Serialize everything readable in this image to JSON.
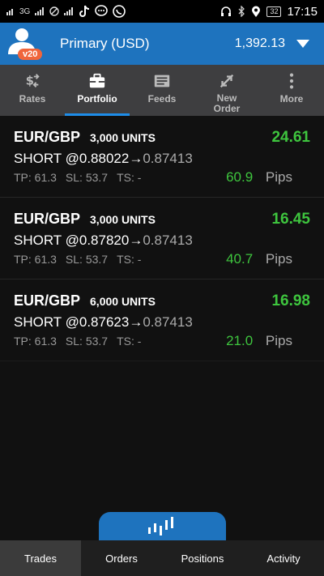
{
  "status_bar": {
    "left_text": "3G",
    "battery": "32",
    "time": "17:15"
  },
  "header": {
    "avatar_badge": "v20",
    "account_name": "Primary (USD)",
    "balance": "1,392.13"
  },
  "nav": [
    {
      "label": "Rates",
      "icon": "rates-icon"
    },
    {
      "label": "Portfolio",
      "icon": "briefcase-icon",
      "active": true
    },
    {
      "label": "Feeds",
      "icon": "feeds-icon"
    },
    {
      "label": "New Order",
      "icon": "new-order-icon"
    },
    {
      "label": "More",
      "icon": "more-icon"
    }
  ],
  "trades": [
    {
      "pair": "EUR/GBP",
      "units": "3,000 UNITS",
      "pl": "24.61",
      "side": "SHORT @",
      "open": "0.88022",
      "arrow": "→",
      "current": "0.87413",
      "tp": "TP: 61.3",
      "sl": "SL: 53.7",
      "ts": "TS: -",
      "pips_value": "60.9",
      "pips_label": "Pips"
    },
    {
      "pair": "EUR/GBP",
      "units": "3,000 UNITS",
      "pl": "16.45",
      "side": "SHORT @",
      "open": "0.87820",
      "arrow": "→",
      "current": "0.87413",
      "tp": "TP: 61.3",
      "sl": "SL: 53.7",
      "ts": "TS: -",
      "pips_value": "40.7",
      "pips_label": "Pips"
    },
    {
      "pair": "EUR/GBP",
      "units": "6,000 UNITS",
      "pl": "16.98",
      "side": "SHORT @",
      "open": "0.87623",
      "arrow": "→",
      "current": "0.87413",
      "tp": "TP: 61.3",
      "sl": "SL: 53.7",
      "ts": "TS: -",
      "pips_value": "21.0",
      "pips_label": "Pips"
    }
  ],
  "bottom_tabs": [
    {
      "label": "Trades",
      "active": true
    },
    {
      "label": "Orders"
    },
    {
      "label": "Positions"
    },
    {
      "label": "Activity"
    }
  ],
  "colors": {
    "accent": "#1e73be",
    "profit": "#3ec53e",
    "badge": "#f0653b",
    "nav_bg": "#3e3e40"
  }
}
